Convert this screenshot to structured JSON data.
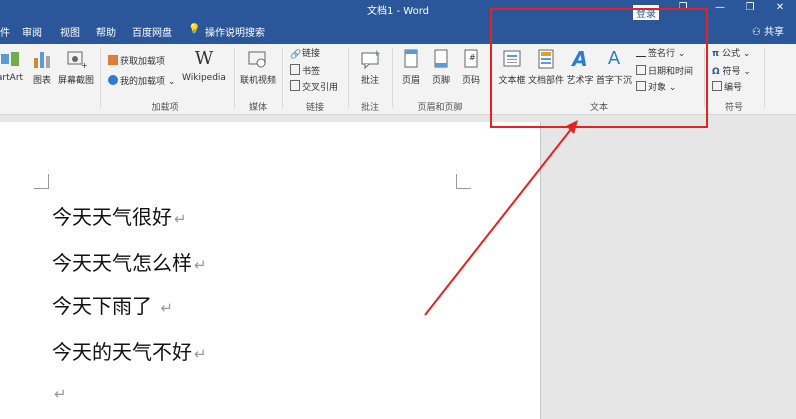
{
  "window": {
    "title": "文档1  -  Word",
    "minimize": "—",
    "restore": "❐",
    "close": "✕",
    "extra_btn": "❐"
  },
  "menu": {
    "items": [
      "件",
      "审阅",
      "视图",
      "帮助",
      "百度网盘"
    ],
    "tell_me": "操作说明搜索",
    "sign_in": "登录",
    "share": "共享"
  },
  "ribbon": {
    "buttons": {
      "smartart": "artArt",
      "chart": "图表",
      "screenshot": "屏幕截图",
      "get_addins": "获取加载项",
      "my_addins": "我的加载项",
      "wikipedia": "Wikipedia",
      "online_video": "联机视频",
      "link": "链接",
      "bookmark": "书签",
      "cross_ref": "交叉引用",
      "comment": "批注",
      "header": "页眉",
      "footer": "页脚",
      "page_number": "页码",
      "textbox": "文本框",
      "quick_parts": "文档部件",
      "wordart": "艺术字",
      "dropcap": "首字下沉",
      "signature_line": "签名行",
      "date_time": "日期和时间",
      "object": "对象",
      "equation": "公式",
      "symbol": "符号",
      "numbering": "编号"
    },
    "groups": {
      "addins": "加载项",
      "media": "媒体",
      "links": "链接",
      "comments": "批注",
      "header_footer": "页眉和页脚",
      "text": "文本",
      "symbols": "符号"
    }
  },
  "document": {
    "lines": [
      "今天天气很好",
      "今天天气怎么样",
      "今天下雨了 ",
      "今天的天气不好"
    ],
    "para_mark": "↵"
  },
  "colors": {
    "titlebar": "#2b579a",
    "highlight": "#e52222",
    "ribbon_bg": "#f3f3f3"
  }
}
